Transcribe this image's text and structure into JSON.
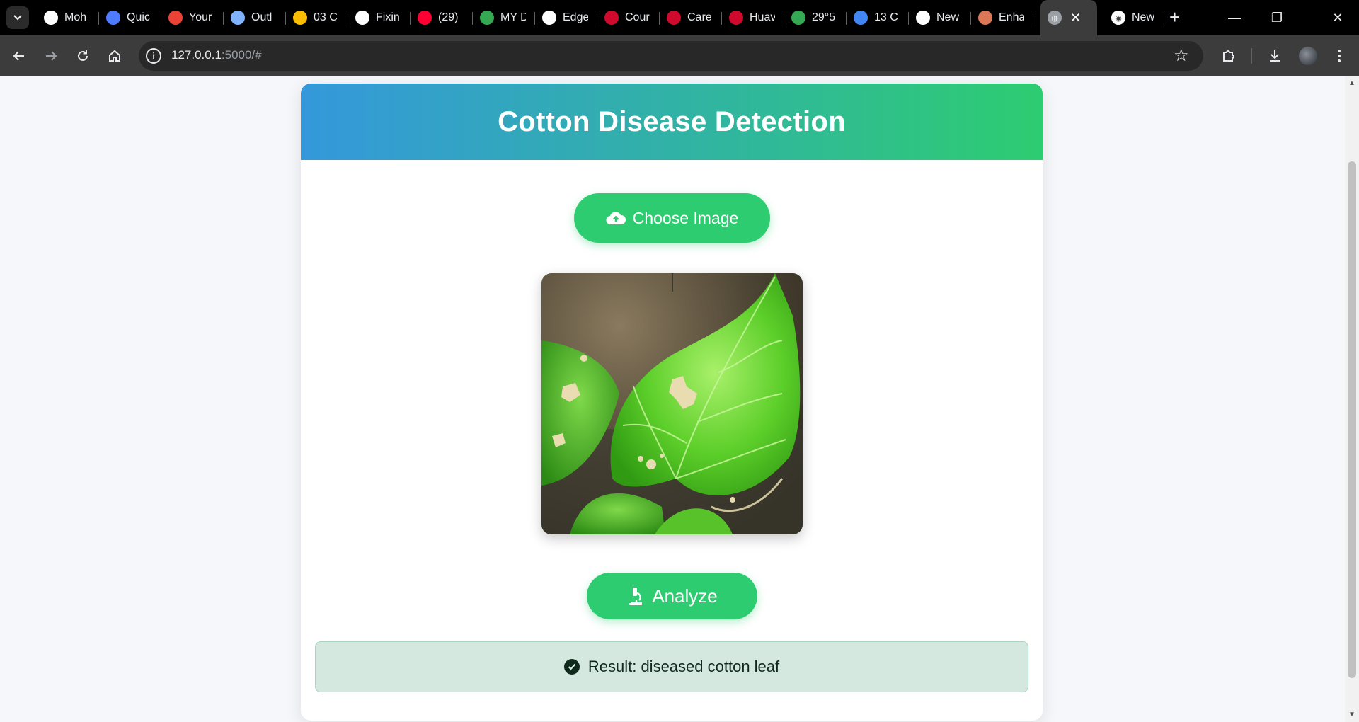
{
  "browser": {
    "tabs": [
      {
        "label": "Moh",
        "icon": "github-icon",
        "color": "#ffffff"
      },
      {
        "label": "Quic",
        "icon": "quickshare-icon",
        "color": "#4f7cff"
      },
      {
        "label": "Your",
        "icon": "gmail-icon",
        "color": "#ea4335"
      },
      {
        "label": "Outl",
        "icon": "copilot-icon",
        "color": "#7fb3ff"
      },
      {
        "label": "03 C",
        "icon": "drive-icon",
        "color": "#fbbc04"
      },
      {
        "label": "Fixin",
        "icon": "chatgpt-icon",
        "color": "#ffffff"
      },
      {
        "label": "(29)",
        "icon": "youtube-icon",
        "color": "#ff0033"
      },
      {
        "label": "MY D",
        "icon": "drive-icon",
        "color": "#34a853"
      },
      {
        "label": "Edge",
        "icon": "chatgpt-icon",
        "color": "#ffffff"
      },
      {
        "label": "Cour",
        "icon": "huawei-icon",
        "color": "#cf0a2c"
      },
      {
        "label": "Care",
        "icon": "huawei-icon",
        "color": "#cf0a2c"
      },
      {
        "label": "Huav",
        "icon": "huawei-icon",
        "color": "#cf0a2c"
      },
      {
        "label": "29°5",
        "icon": "maps-pin-icon",
        "color": "#34a853"
      },
      {
        "label": "13 C",
        "icon": "drive-icon",
        "color": "#4285f4"
      },
      {
        "label": "New",
        "icon": "github-icon",
        "color": "#ffffff"
      },
      {
        "label": "Enha",
        "icon": "claude-icon",
        "color": "#d97757"
      }
    ],
    "active_tab_close": "✕",
    "last_tab": {
      "label": "New",
      "icon": "chrome-icon"
    },
    "url_host": "127.0.0.1",
    "url_rest": ":5000/#"
  },
  "app": {
    "title": "Cotton Disease Detection",
    "choose_label": "Choose Image",
    "analyze_label": "Analyze",
    "result_text": "Result: diseased cotton leaf",
    "accent_color": "#2ecc71",
    "header_gradient": [
      "#3498db",
      "#2ecc71"
    ],
    "result_bg": "#d4e8df"
  }
}
